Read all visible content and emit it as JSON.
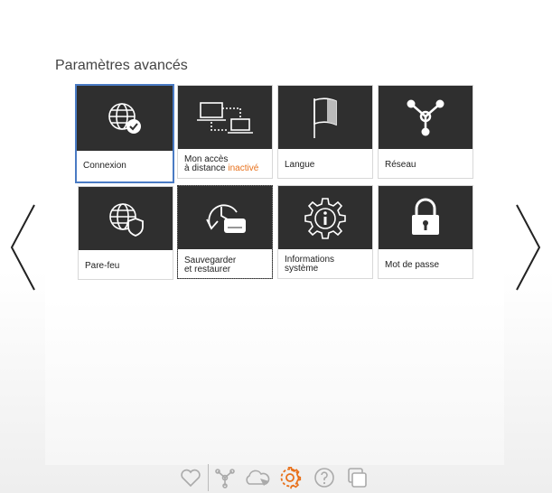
{
  "panel": {
    "title": "Paramètres avancés"
  },
  "tiles": [
    {
      "label": "Connexion",
      "icon": "globe-check-icon"
    },
    {
      "label": "Mon accès\nà distance ",
      "status": "inactivé",
      "icon": "remote-computers-icon"
    },
    {
      "label": "Langue",
      "icon": "flag-icon"
    },
    {
      "label": "Réseau",
      "icon": "network-icon"
    },
    {
      "label": "Pare-feu",
      "icon": "globe-shield-icon"
    },
    {
      "label": "Sauvegarder\net restaurer",
      "icon": "backup-restore-icon"
    },
    {
      "label": "Informations\nsystème",
      "icon": "gear-info-icon"
    },
    {
      "label": "Mot de passe",
      "icon": "lock-icon"
    }
  ],
  "nav": {
    "prev_icon": "chevron-left-icon",
    "next_icon": "chevron-right-icon"
  },
  "bottom_bar": [
    "heart-icon",
    "network-icon",
    "cloud-icon",
    "gear-icon",
    "help-icon",
    "windows-icon"
  ],
  "colors": {
    "accent": "#e8701a",
    "selection": "#4a7bc4",
    "tile_dark": "#2f2f2f"
  }
}
